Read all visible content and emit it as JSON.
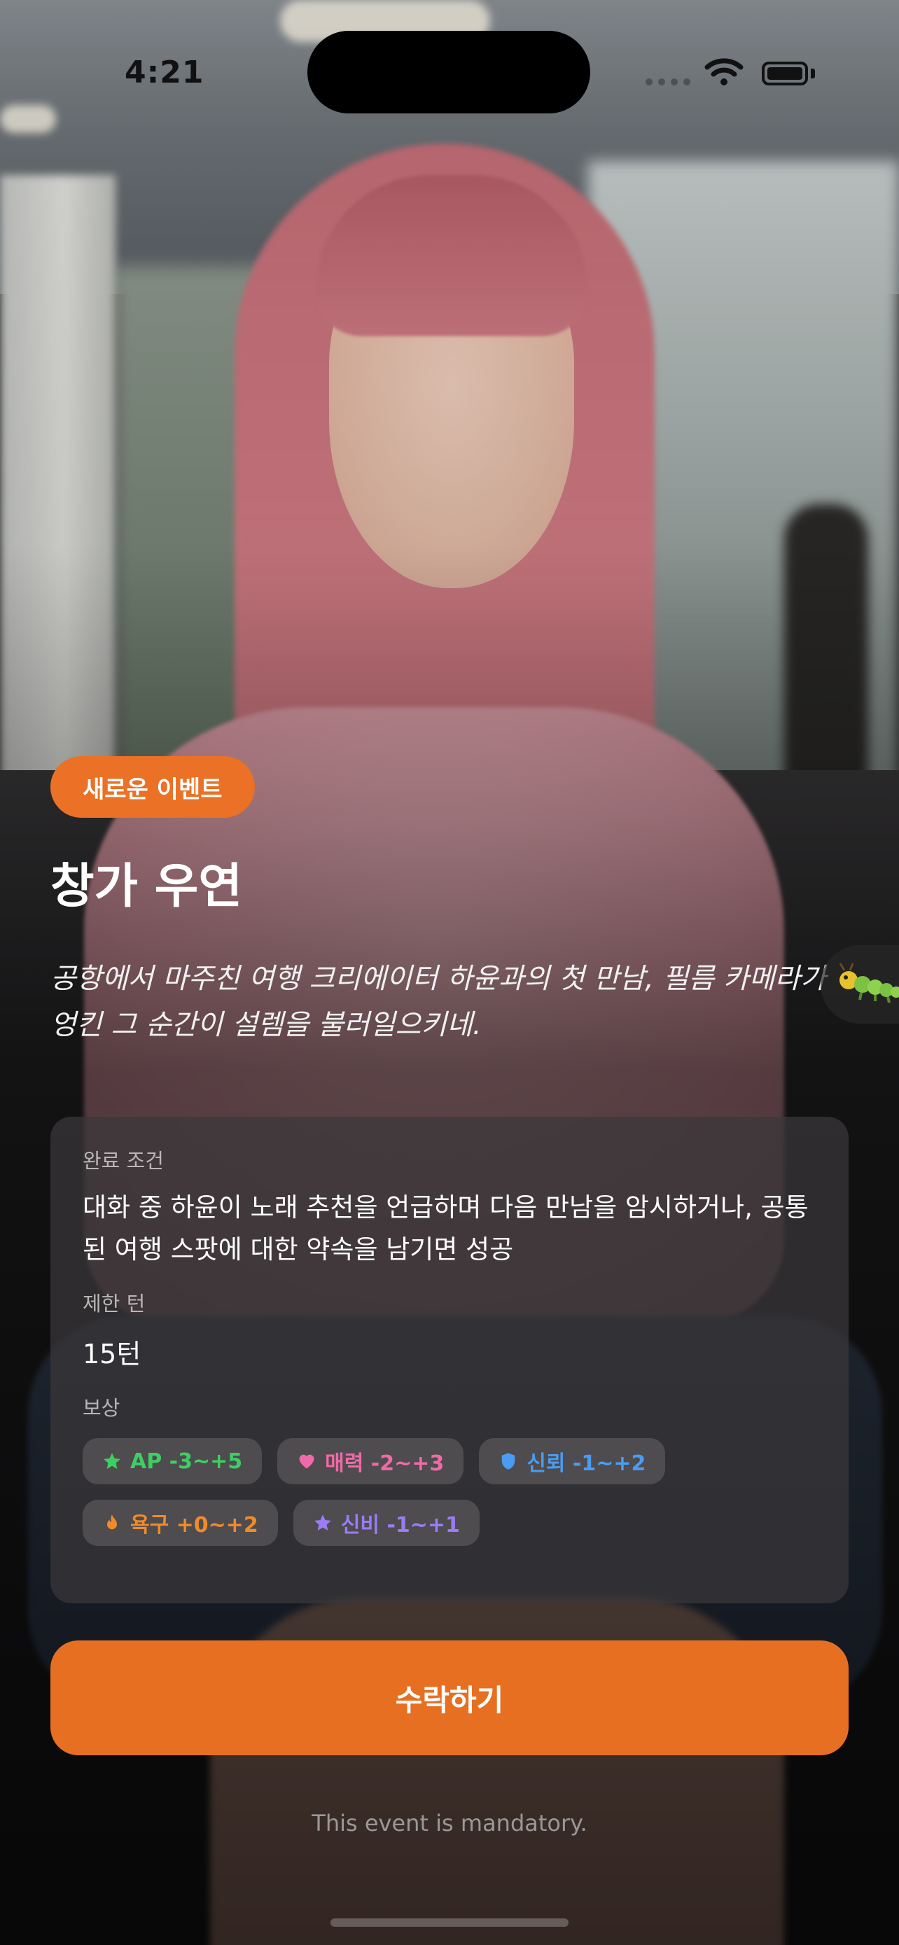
{
  "status_bar": {
    "time": "4:21"
  },
  "event": {
    "badge": "새로운 이벤트",
    "title": "창가 우연",
    "description": "공항에서 마주친 여행 크리에이터 하윤과의 첫 만남, 필름 카메라가 엉킨 그 순간이 설렘을 불러일으키네."
  },
  "details": {
    "condition_label": "완료 조건",
    "condition_text": "대화 중 하윤이 노래 추천을 언급하며 다음 만남을 암시하거나, 공통된 여행 스팟에 대한 약속을 남기면 성공",
    "turn_label": "제한 턴",
    "turn_value": "15턴",
    "reward_label": "보상",
    "rewards": [
      {
        "label": "AP -3~+5",
        "icon": "star-icon",
        "color": "#3ecf62"
      },
      {
        "label": "매력 -2~+3",
        "icon": "heart-icon",
        "color": "#f06aa7"
      },
      {
        "label": "신뢰 -1~+2",
        "icon": "shield-icon",
        "color": "#4a9cf0"
      },
      {
        "label": "욕구 +0~+2",
        "icon": "flame-icon",
        "color": "#f08a2a"
      },
      {
        "label": "신비 -1~+1",
        "icon": "star-icon",
        "color": "#9b7cf6"
      }
    ]
  },
  "actions": {
    "accept_label": "수락하기",
    "mandatory_note": "This event is mandatory."
  },
  "side_tab": {
    "icon": "caterpillar-icon"
  }
}
